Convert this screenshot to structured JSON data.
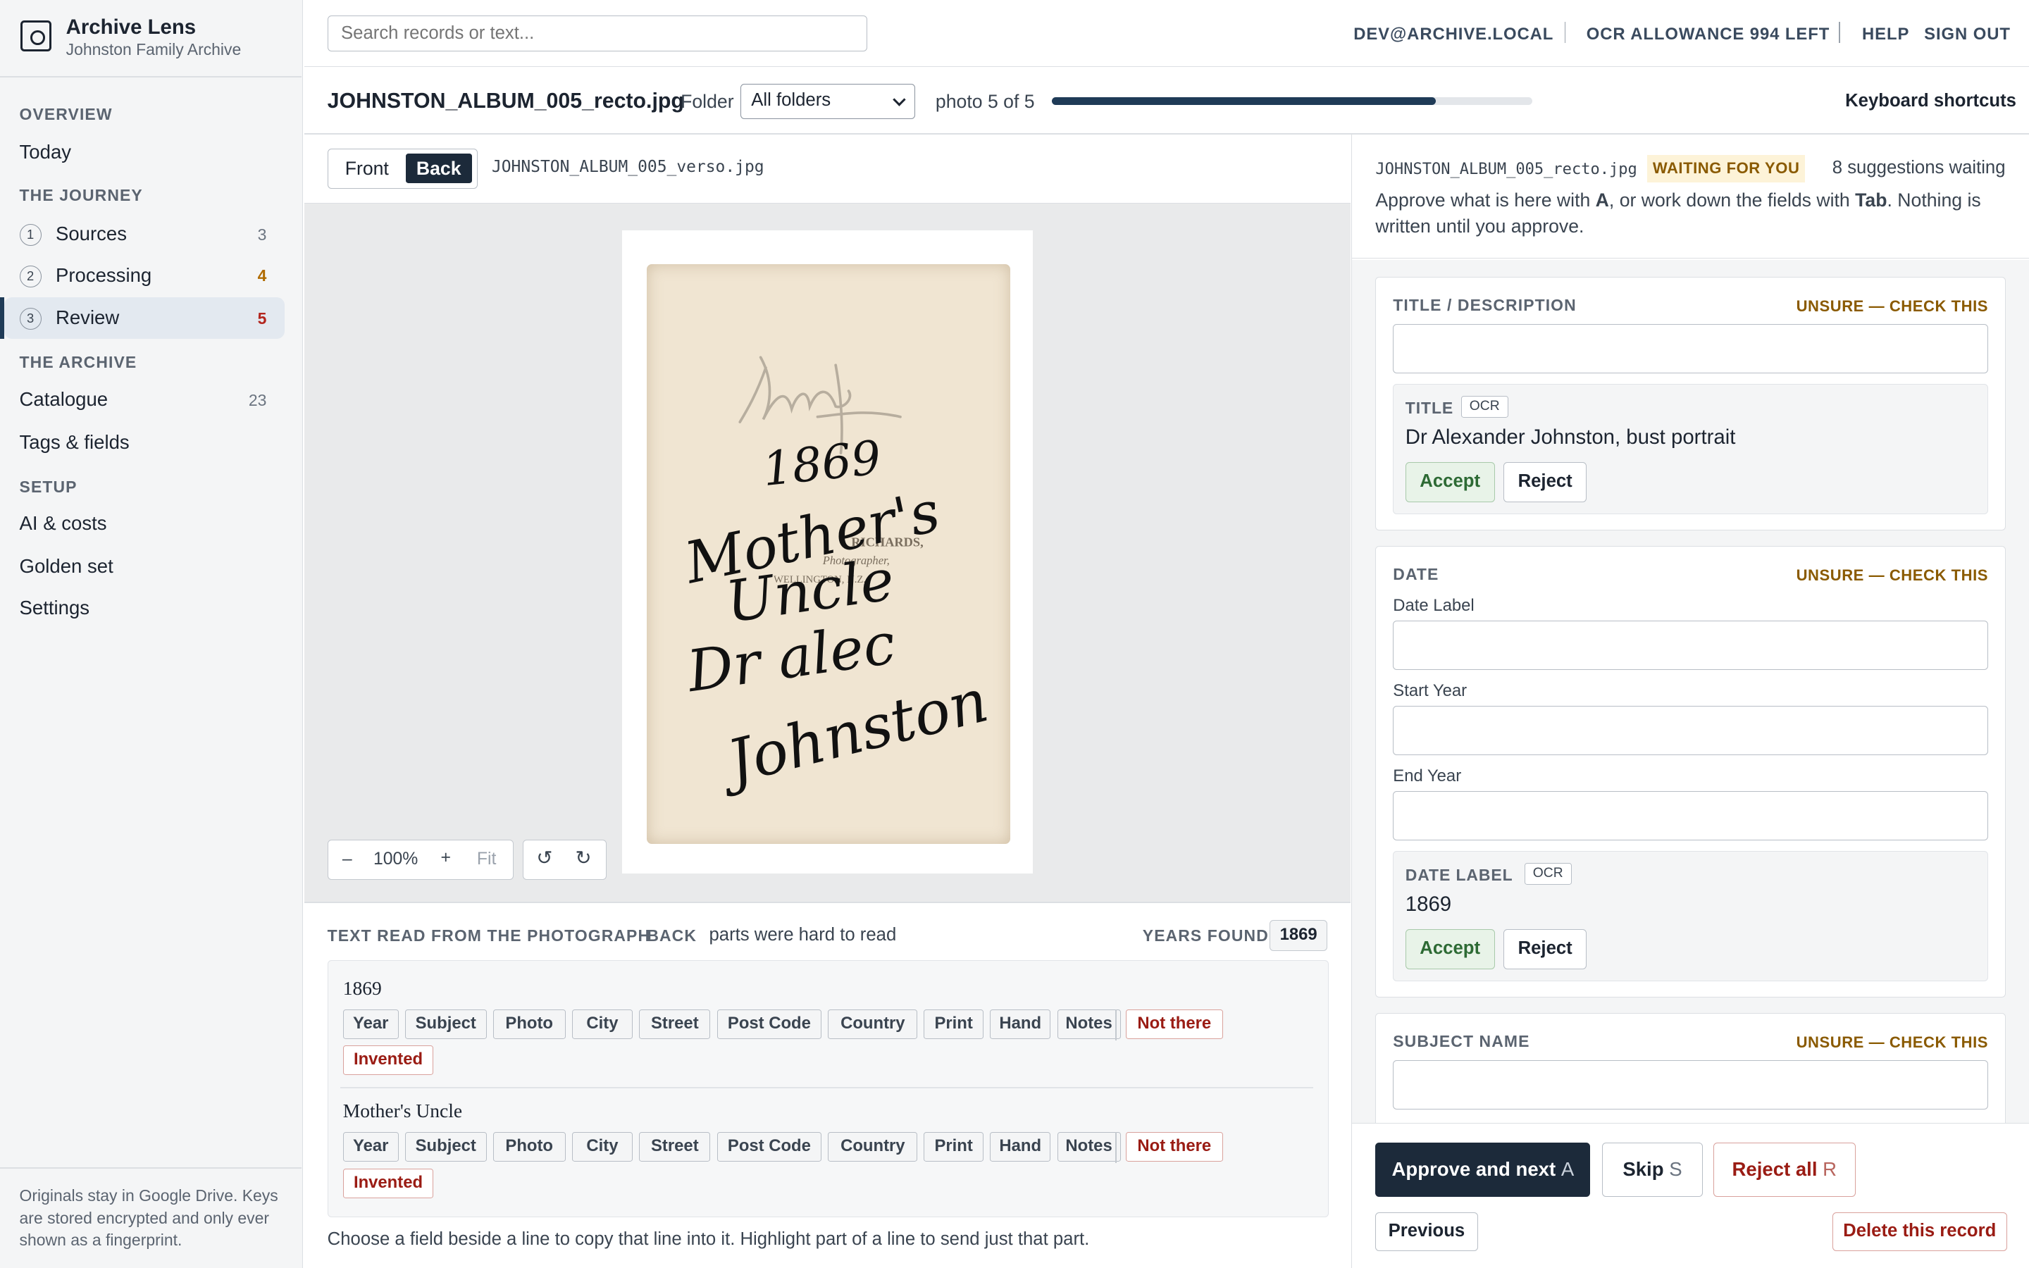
{
  "app": {
    "name": "Archive Lens",
    "subtitle": "Johnston Family Archive"
  },
  "sidebar": {
    "overview_heading": "OVERVIEW",
    "today": "Today",
    "journey_heading": "THE JOURNEY",
    "journey": [
      {
        "num": "1",
        "label": "Sources",
        "count": "3"
      },
      {
        "num": "2",
        "label": "Processing",
        "count": "4"
      },
      {
        "num": "3",
        "label": "Review",
        "count": "5"
      }
    ],
    "archive_heading": "THE ARCHIVE",
    "archive": [
      {
        "label": "Catalogue",
        "count": "23"
      },
      {
        "label": "Tags & fields"
      }
    ],
    "setup_heading": "SETUP",
    "setup": [
      "AI & costs",
      "Golden set",
      "Settings"
    ],
    "footer": "Originals stay in Google Drive. Keys are stored encrypted and only ever shown as a fingerprint."
  },
  "topbar": {
    "search_placeholder": "Search records or text...",
    "account": "DEV@ARCHIVE.LOCAL",
    "ocr": "OCR ALLOWANCE 994 LEFT",
    "help": "HELP",
    "signout": "SIGN OUT"
  },
  "filebar": {
    "filename": "JOHNSTON_ALBUM_005_recto.jpg",
    "folder_label": "Folder",
    "folder_value": "All folders",
    "photo_count": "photo 5 of 5",
    "progress": 0.8,
    "shortcuts": "Keyboard shortcuts"
  },
  "viewer": {
    "front": "Front",
    "back": "Back",
    "verso": "JOHNSTON_ALBUM_005_verso.jpg",
    "zoom_minus": "–",
    "zoom": "100%",
    "zoom_plus": "+",
    "fit": "Fit",
    "rotate_left": "↺",
    "rotate_right": "↻",
    "handwriting": [
      "1869",
      "Mother's",
      "Uncle",
      "Dr alec",
      "Johnston"
    ],
    "stamp": [
      "RICHARDS,",
      "Photographer,",
      "WELLINGTON, N.Z."
    ]
  },
  "textread": {
    "heading": "TEXT READ FROM THE PHOTOGRAPH",
    "side": "BACK",
    "note": "parts were hard to read",
    "years_label": "YEARS FOUND",
    "year": "1869",
    "field_chips": [
      "Year",
      "Subject",
      "Photo",
      "City",
      "Street",
      "Post Code",
      "Country",
      "Print",
      "Hand",
      "Notes"
    ],
    "not_there": "Not there",
    "invented": "Invented",
    "lines": [
      "1869",
      "Mother's Uncle"
    ],
    "hint": "Choose a field beside a line to copy that line into it. Highlight part of a line to send just that part."
  },
  "review": {
    "filename": "JOHNSTON_ALBUM_005_recto.jpg",
    "status": "WAITING FOR YOU",
    "suggestions": "8 suggestions waiting",
    "instr_a": "Approve what is here with ",
    "key_a": "A",
    "instr_b": ", or work down the fields with ",
    "key_tab": "Tab",
    "instr_c": ". Nothing is written until you approve.",
    "unsure": "UNSURE — CHECK THIS",
    "ocr_tag": "OCR",
    "accept": "Accept",
    "reject": "Reject",
    "title_card": {
      "heading": "TITLE / DESCRIPTION",
      "sug_label": "TITLE",
      "sug_value": "Dr Alexander Johnston, bust portrait"
    },
    "date_card": {
      "heading": "DATE",
      "date_label": "Date Label",
      "start_year": "Start Year",
      "end_year": "End Year",
      "sug_label": "DATE LABEL",
      "sug_value": "1869"
    },
    "subject_card": {
      "heading": "SUBJECT NAME"
    }
  },
  "actions": {
    "approve": "Approve and next",
    "approve_key": "A",
    "skip": "Skip",
    "skip_key": "S",
    "reject_all": "Reject all",
    "reject_key": "R",
    "previous": "Previous",
    "delete": "Delete this record"
  }
}
